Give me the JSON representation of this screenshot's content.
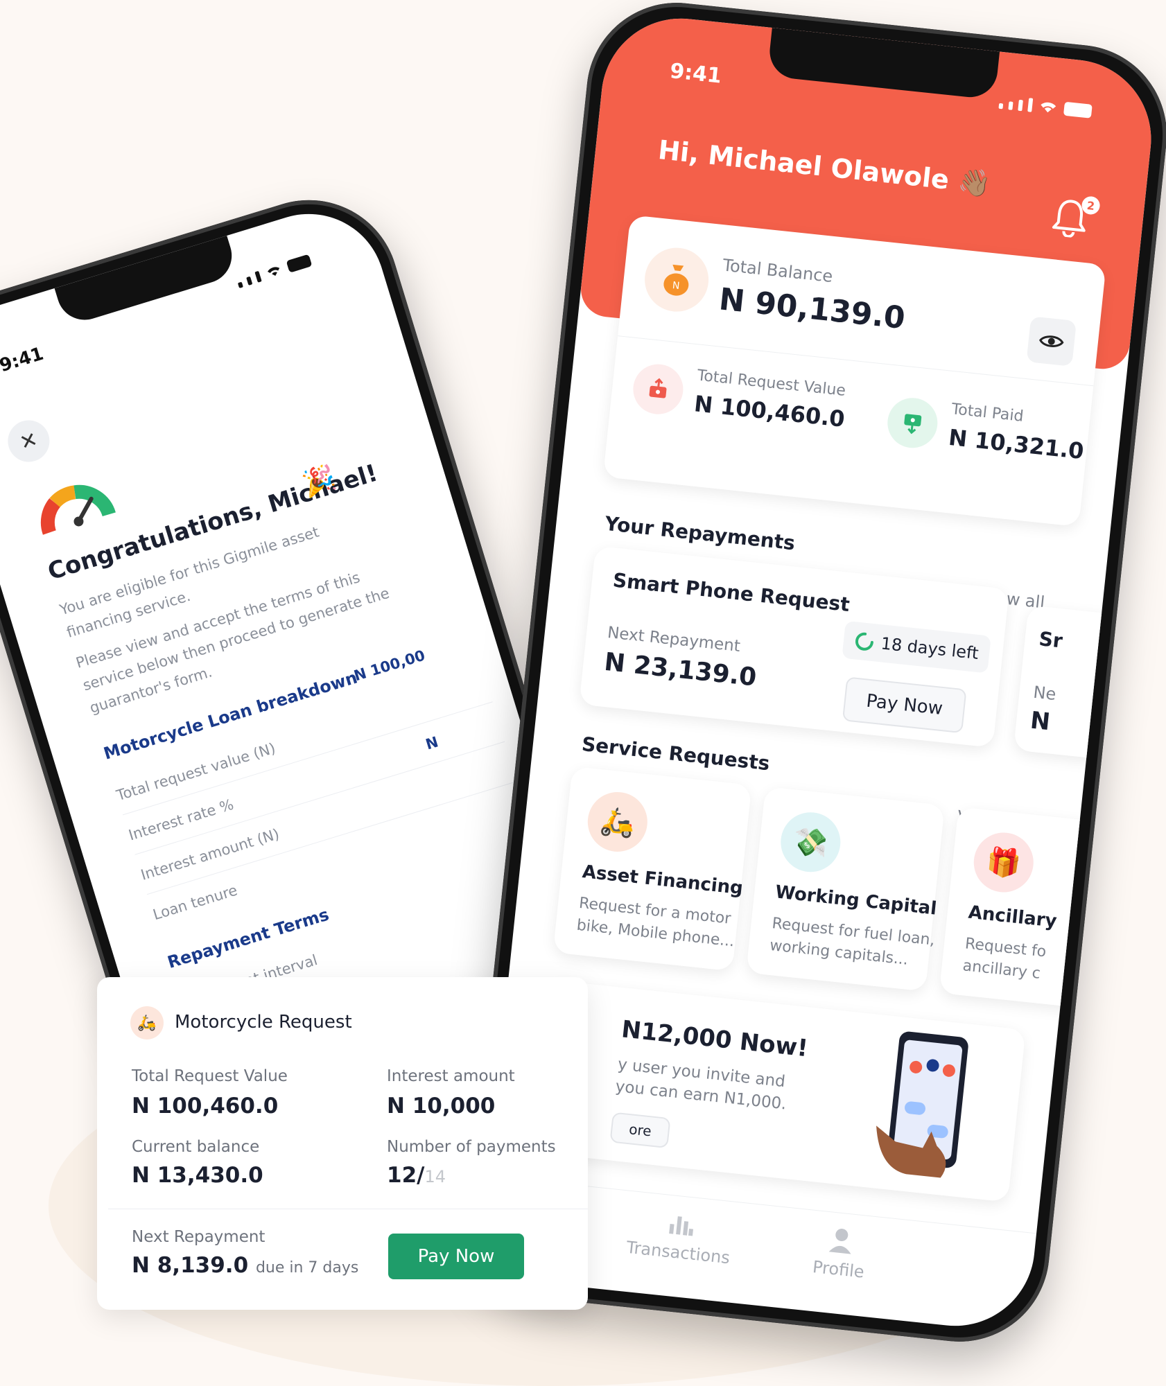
{
  "left_phone": {
    "time": "9:41",
    "close_label": "✕",
    "title": "Congratulations, Michael!",
    "paragraph1": "You are eligible for this Gigmile asset financing service.",
    "paragraph2": "Please view and accept the terms of this service below then proceed to generate the guarantor's form.",
    "breakdown_title": "Motorcycle Loan breakdown",
    "rows": [
      {
        "label": "Total request value (N)",
        "value": "N 100,00"
      },
      {
        "label": "Interest rate %",
        "value": "N"
      },
      {
        "label": "Interest amount (N)",
        "value": ""
      },
      {
        "label": "Loan tenure",
        "value": ""
      }
    ],
    "terms_title": "Repayment Terms",
    "terms_rows": [
      {
        "label": "Repayment interval"
      }
    ]
  },
  "right_phone": {
    "time": "9:41",
    "greeting": "Hi, Michael Olawole 👋🏽",
    "notifications": "2",
    "total_balance": {
      "label": "Total Balance",
      "value": "N 90,139.0"
    },
    "total_request": {
      "label": "Total Request Value",
      "value": "N 100,460.0"
    },
    "total_paid": {
      "label": "Total Paid",
      "value": "N 10,321.0"
    },
    "repayments": {
      "title": "Your Repayments",
      "view_all": "View all",
      "item": {
        "title": "Smart Phone Request",
        "days_left": "18 days left",
        "next_label": "Next Repayment",
        "next_value": "N 23,139.0",
        "pay_label": "Pay Now"
      },
      "peek": {
        "title": "Sr",
        "label": "Ne",
        "value": "N"
      }
    },
    "services": {
      "title": "Service Requests",
      "view_all": "View all",
      "items": [
        {
          "title": "Asset Financing",
          "desc1": "Request for a motor",
          "desc2": "bike, Mobile phone..."
        },
        {
          "title": "Working Capital",
          "desc1": "Request for fuel loan,",
          "desc2": "working capitals..."
        },
        {
          "title": "Ancillary",
          "desc1": "Request fo",
          "desc2": "ancillary c"
        }
      ]
    },
    "promo": {
      "title": "N12,000 Now!",
      "line1": "y user you invite and",
      "line2": "you can earn N1,000.",
      "more": "ore"
    },
    "tabs": {
      "transactions": "Transactions",
      "profile": "Profile"
    }
  },
  "request_card": {
    "title": "Motorcycle Request",
    "total_label": "Total Request Value",
    "total_value": "N 100,460.0",
    "interest_label": "Interest amount",
    "interest_value": "N 10,000",
    "balance_label": "Current balance",
    "balance_value": "N 13,430.0",
    "payments_label": "Number of payments",
    "payments_done": "12/",
    "payments_total": "14",
    "next_label": "Next Repayment",
    "next_value": "N 8,139.0",
    "due_text": "due in 7 days",
    "pay_label": "Pay Now"
  },
  "colors": {
    "brand": "#f4604a",
    "success": "#1f9d6a",
    "navy": "#1a3a8a"
  }
}
